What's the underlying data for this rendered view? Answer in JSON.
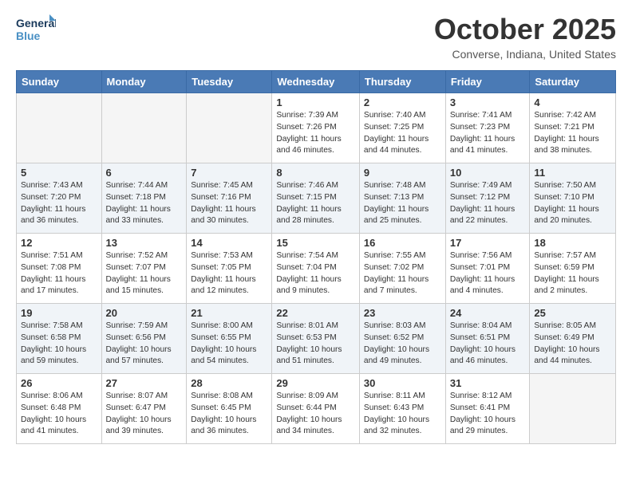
{
  "header": {
    "logo_line1": "General",
    "logo_line2": "Blue",
    "month": "October 2025",
    "location": "Converse, Indiana, United States"
  },
  "days_of_week": [
    "Sunday",
    "Monday",
    "Tuesday",
    "Wednesday",
    "Thursday",
    "Friday",
    "Saturday"
  ],
  "weeks": [
    [
      {
        "day": "",
        "info": ""
      },
      {
        "day": "",
        "info": ""
      },
      {
        "day": "",
        "info": ""
      },
      {
        "day": "1",
        "info": "Sunrise: 7:39 AM\nSunset: 7:26 PM\nDaylight: 11 hours\nand 46 minutes."
      },
      {
        "day": "2",
        "info": "Sunrise: 7:40 AM\nSunset: 7:25 PM\nDaylight: 11 hours\nand 44 minutes."
      },
      {
        "day": "3",
        "info": "Sunrise: 7:41 AM\nSunset: 7:23 PM\nDaylight: 11 hours\nand 41 minutes."
      },
      {
        "day": "4",
        "info": "Sunrise: 7:42 AM\nSunset: 7:21 PM\nDaylight: 11 hours\nand 38 minutes."
      }
    ],
    [
      {
        "day": "5",
        "info": "Sunrise: 7:43 AM\nSunset: 7:20 PM\nDaylight: 11 hours\nand 36 minutes."
      },
      {
        "day": "6",
        "info": "Sunrise: 7:44 AM\nSunset: 7:18 PM\nDaylight: 11 hours\nand 33 minutes."
      },
      {
        "day": "7",
        "info": "Sunrise: 7:45 AM\nSunset: 7:16 PM\nDaylight: 11 hours\nand 30 minutes."
      },
      {
        "day": "8",
        "info": "Sunrise: 7:46 AM\nSunset: 7:15 PM\nDaylight: 11 hours\nand 28 minutes."
      },
      {
        "day": "9",
        "info": "Sunrise: 7:48 AM\nSunset: 7:13 PM\nDaylight: 11 hours\nand 25 minutes."
      },
      {
        "day": "10",
        "info": "Sunrise: 7:49 AM\nSunset: 7:12 PM\nDaylight: 11 hours\nand 22 minutes."
      },
      {
        "day": "11",
        "info": "Sunrise: 7:50 AM\nSunset: 7:10 PM\nDaylight: 11 hours\nand 20 minutes."
      }
    ],
    [
      {
        "day": "12",
        "info": "Sunrise: 7:51 AM\nSunset: 7:08 PM\nDaylight: 11 hours\nand 17 minutes."
      },
      {
        "day": "13",
        "info": "Sunrise: 7:52 AM\nSunset: 7:07 PM\nDaylight: 11 hours\nand 15 minutes."
      },
      {
        "day": "14",
        "info": "Sunrise: 7:53 AM\nSunset: 7:05 PM\nDaylight: 11 hours\nand 12 minutes."
      },
      {
        "day": "15",
        "info": "Sunrise: 7:54 AM\nSunset: 7:04 PM\nDaylight: 11 hours\nand 9 minutes."
      },
      {
        "day": "16",
        "info": "Sunrise: 7:55 AM\nSunset: 7:02 PM\nDaylight: 11 hours\nand 7 minutes."
      },
      {
        "day": "17",
        "info": "Sunrise: 7:56 AM\nSunset: 7:01 PM\nDaylight: 11 hours\nand 4 minutes."
      },
      {
        "day": "18",
        "info": "Sunrise: 7:57 AM\nSunset: 6:59 PM\nDaylight: 11 hours\nand 2 minutes."
      }
    ],
    [
      {
        "day": "19",
        "info": "Sunrise: 7:58 AM\nSunset: 6:58 PM\nDaylight: 10 hours\nand 59 minutes."
      },
      {
        "day": "20",
        "info": "Sunrise: 7:59 AM\nSunset: 6:56 PM\nDaylight: 10 hours\nand 57 minutes."
      },
      {
        "day": "21",
        "info": "Sunrise: 8:00 AM\nSunset: 6:55 PM\nDaylight: 10 hours\nand 54 minutes."
      },
      {
        "day": "22",
        "info": "Sunrise: 8:01 AM\nSunset: 6:53 PM\nDaylight: 10 hours\nand 51 minutes."
      },
      {
        "day": "23",
        "info": "Sunrise: 8:03 AM\nSunset: 6:52 PM\nDaylight: 10 hours\nand 49 minutes."
      },
      {
        "day": "24",
        "info": "Sunrise: 8:04 AM\nSunset: 6:51 PM\nDaylight: 10 hours\nand 46 minutes."
      },
      {
        "day": "25",
        "info": "Sunrise: 8:05 AM\nSunset: 6:49 PM\nDaylight: 10 hours\nand 44 minutes."
      }
    ],
    [
      {
        "day": "26",
        "info": "Sunrise: 8:06 AM\nSunset: 6:48 PM\nDaylight: 10 hours\nand 41 minutes."
      },
      {
        "day": "27",
        "info": "Sunrise: 8:07 AM\nSunset: 6:47 PM\nDaylight: 10 hours\nand 39 minutes."
      },
      {
        "day": "28",
        "info": "Sunrise: 8:08 AM\nSunset: 6:45 PM\nDaylight: 10 hours\nand 36 minutes."
      },
      {
        "day": "29",
        "info": "Sunrise: 8:09 AM\nSunset: 6:44 PM\nDaylight: 10 hours\nand 34 minutes."
      },
      {
        "day": "30",
        "info": "Sunrise: 8:11 AM\nSunset: 6:43 PM\nDaylight: 10 hours\nand 32 minutes."
      },
      {
        "day": "31",
        "info": "Sunrise: 8:12 AM\nSunset: 6:41 PM\nDaylight: 10 hours\nand 29 minutes."
      },
      {
        "day": "",
        "info": ""
      }
    ]
  ]
}
